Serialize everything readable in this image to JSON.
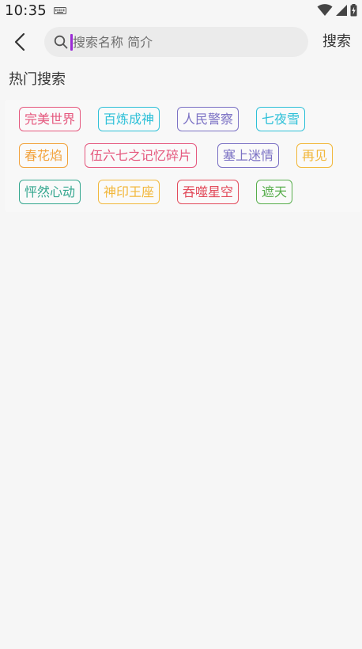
{
  "status_bar": {
    "time": "10:35",
    "icons": [
      "keyboard-icon",
      "wifi-icon",
      "signal-icon",
      "battery-charging-icon"
    ]
  },
  "header": {
    "back_icon": "chevron-left-icon",
    "search_placeholder": "搜索名称 简介",
    "search_value": "",
    "search_button": "搜索"
  },
  "hot_search": {
    "title": "热门搜索",
    "tags": [
      {
        "label": "完美世界",
        "color": "#e5587e"
      },
      {
        "label": "百炼成神",
        "color": "#2ec0d8"
      },
      {
        "label": "人民警察",
        "color": "#7b71c4"
      },
      {
        "label": "七夜雪",
        "color": "#2ec0d8"
      },
      {
        "label": "春花焰",
        "color": "#f2a23c"
      },
      {
        "label": "伍六七之记忆碎片",
        "color": "#e5587e"
      },
      {
        "label": "塞上迷情",
        "color": "#7b71c4"
      },
      {
        "label": "再见",
        "color": "#f2b73a"
      },
      {
        "label": "怦然心动",
        "color": "#33a68e"
      },
      {
        "label": "神印王座",
        "color": "#f2b73a"
      },
      {
        "label": "吞噬星空",
        "color": "#e24a5a"
      },
      {
        "label": "遮天",
        "color": "#57ad4b"
      }
    ]
  },
  "colors": {
    "background": "#f6f6f6",
    "search_box": "#ebebeb",
    "caret": "#9b2bd6"
  }
}
